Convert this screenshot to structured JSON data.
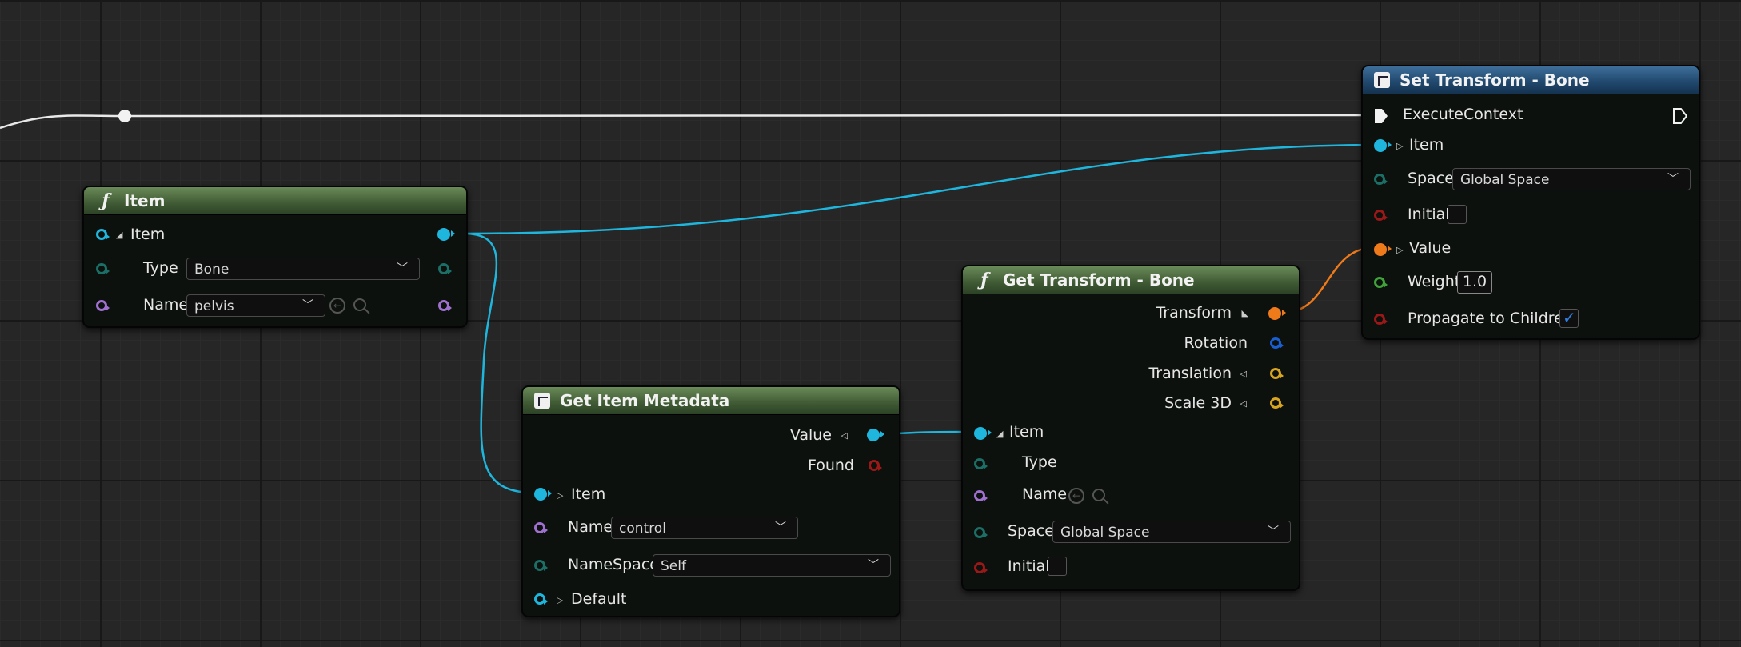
{
  "colors": {
    "wire_struct_cyan": "#1fb6de",
    "wire_transform_orange": "#ef7a1a",
    "wire_exec": "#e8e8e8",
    "pin_teal": "#1b6f66",
    "pin_purple": "#a070d0",
    "pin_red": "#9a1818",
    "pin_green": "#3fa33a",
    "pin_blue": "#1a5fd0",
    "pin_gold": "#d7a520"
  },
  "item_node": {
    "title": "Item",
    "icon": "function-icon",
    "rows": {
      "item": "Item",
      "type": "Type",
      "name": "Name"
    },
    "type_value": "Bone",
    "name_value": "pelvis"
  },
  "metadata_node": {
    "title": "Get Item Metadata",
    "icon": "rig-unit-icon",
    "outputs": {
      "value": "Value",
      "found": "Found"
    },
    "inputs": {
      "item": "Item",
      "name": "Name",
      "namespace": "NameSpace",
      "default": "Default"
    },
    "name_value": "control",
    "namespace_value": "Self"
  },
  "get_transform_node": {
    "title": "Get Transform - Bone",
    "icon": "function-icon",
    "outputs": {
      "transform": "Transform",
      "rotation": "Rotation",
      "translation": "Translation",
      "scale": "Scale 3D"
    },
    "inputs": {
      "item": "Item",
      "type": "Type",
      "name": "Name",
      "space": "Space",
      "initial": "Initial"
    },
    "space_value": "Global Space",
    "initial_checked": false
  },
  "set_transform_node": {
    "title": "Set Transform - Bone",
    "icon": "rig-unit-icon",
    "rows": {
      "execute": "ExecuteContext",
      "item": "Item",
      "space": "Space",
      "initial": "Initial",
      "value": "Value",
      "weight": "Weight",
      "propagate": "Propagate to Children"
    },
    "space_value": "Global Space",
    "weight_value": "1.0",
    "initial_checked": false,
    "propagate_checked": true
  }
}
